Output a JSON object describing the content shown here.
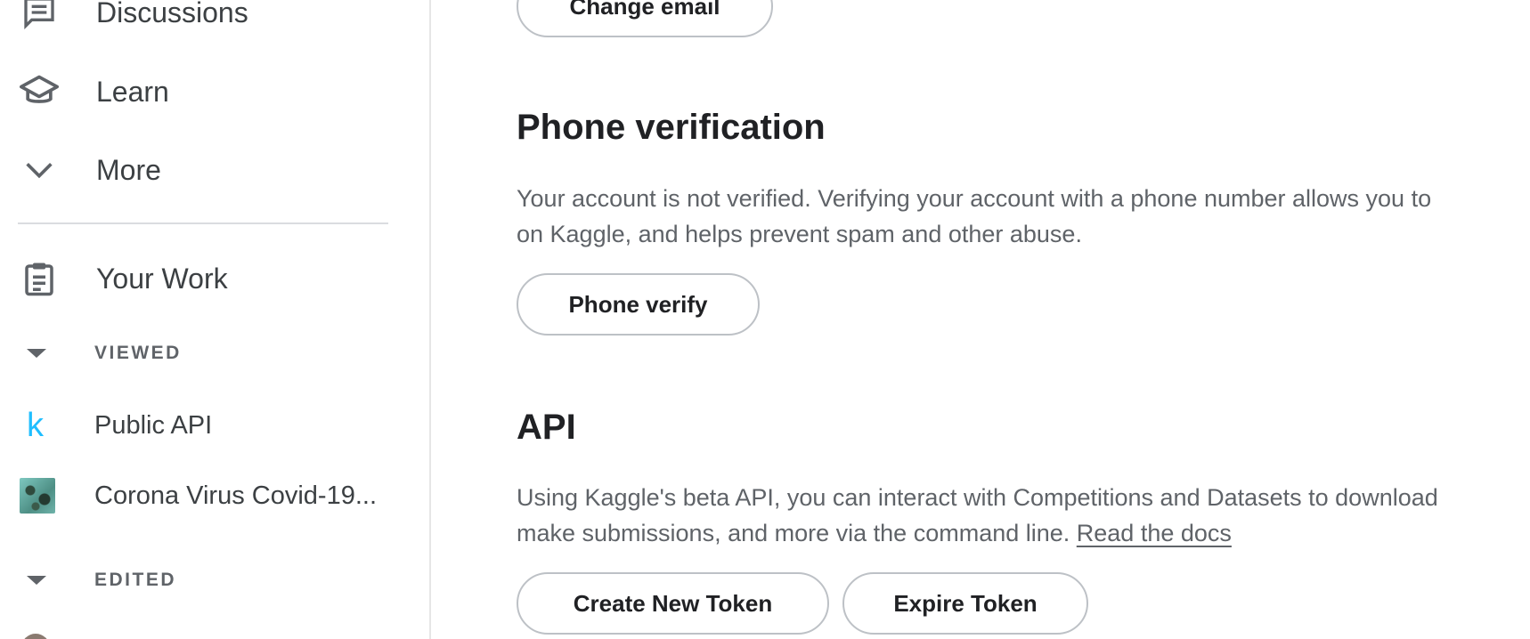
{
  "sidebar": {
    "nav": [
      {
        "label": "Discussions",
        "icon": "discussions-icon"
      },
      {
        "label": "Learn",
        "icon": "learn-icon"
      },
      {
        "label": "More",
        "icon": "chevron-down-icon"
      },
      {
        "label": "Your Work",
        "icon": "clipboard-icon"
      }
    ],
    "viewed": {
      "header": "VIEWED",
      "items": [
        {
          "label": "Public API",
          "icon": "kaggle-k-icon"
        },
        {
          "label": "Corona Virus Covid-19...",
          "icon": "dataset-thumbnail"
        }
      ]
    },
    "edited": {
      "header": "EDITED"
    }
  },
  "main": {
    "change_email_label": "Change email",
    "phone": {
      "title": "Phone verification",
      "line1": "Your account is not verified. Verifying your account with a phone number allows you to",
      "line2": "on Kaggle, and helps prevent spam and other abuse.",
      "button": "Phone verify"
    },
    "api": {
      "title": "API",
      "line1": "Using Kaggle's beta API, you can interact with Competitions and Datasets to download",
      "line2": "make submissions, and more via the command line. ",
      "link": "Read the docs",
      "create_token": "Create New Token",
      "expire_token": "Expire Token"
    }
  },
  "colors": {
    "accent_k": "#20beff",
    "text_primary": "#202124",
    "text_secondary": "#5f6368",
    "border": "#bdc1c6"
  }
}
